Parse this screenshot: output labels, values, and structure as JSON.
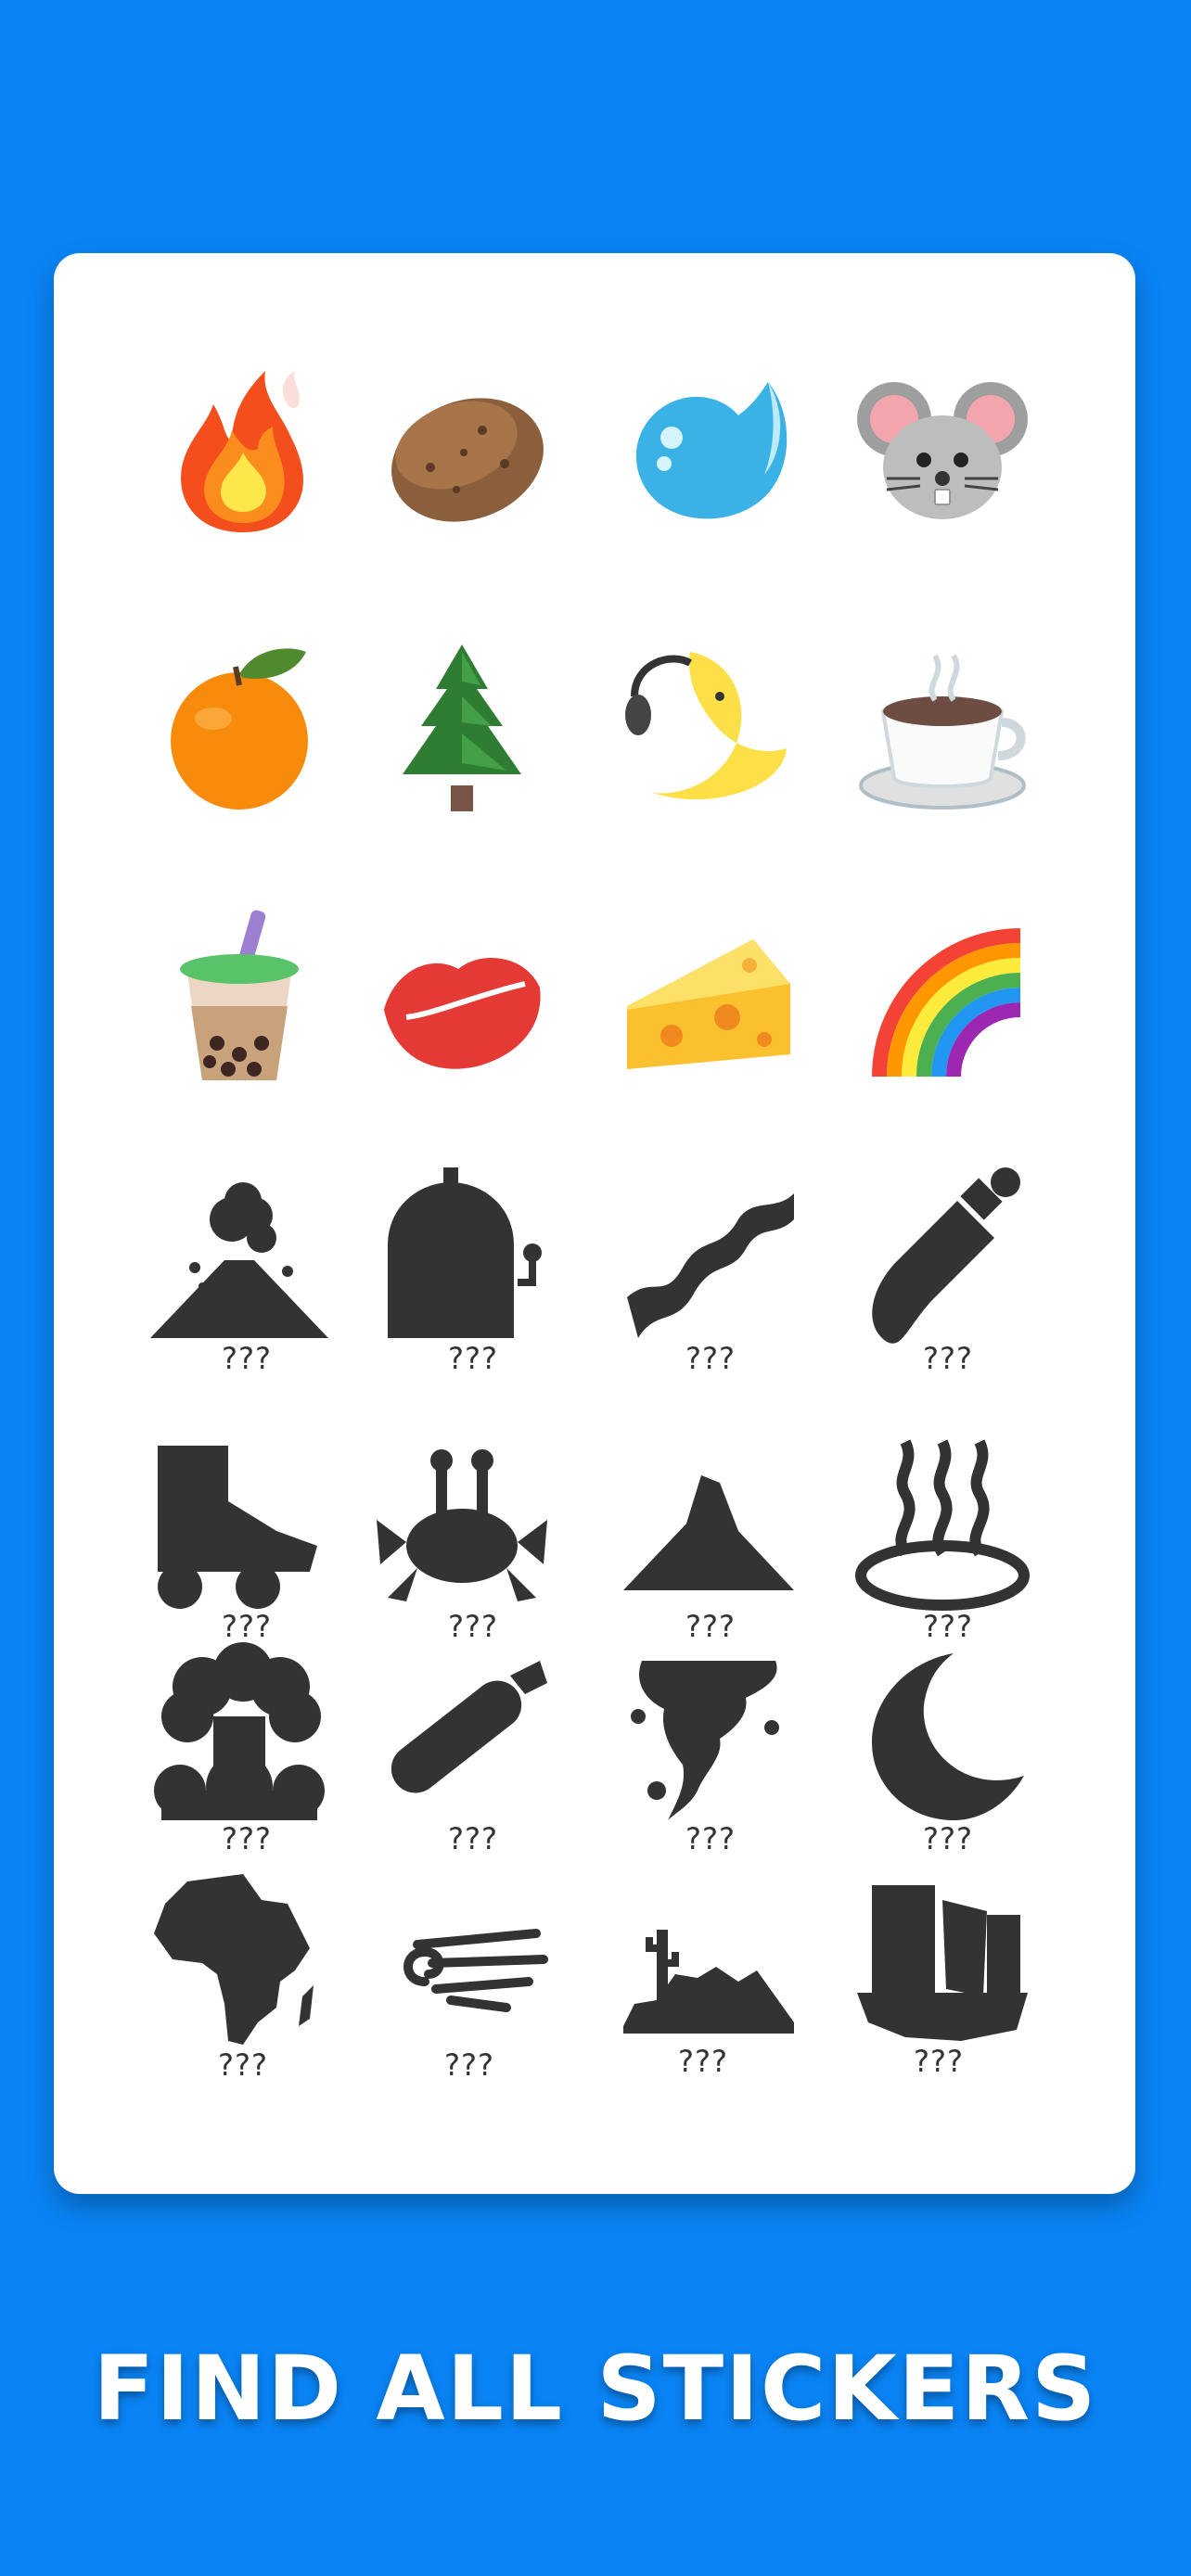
{
  "unlocked": [
    {
      "name": "fire-sticker",
      "icon": "fire-icon"
    },
    {
      "name": "potato-sticker",
      "icon": "potato-icon"
    },
    {
      "name": "water-drop-sticker",
      "icon": "water-drop-icon"
    },
    {
      "name": "mouse-sticker",
      "icon": "mouse-face-icon"
    },
    {
      "name": "tangerine-sticker",
      "icon": "tangerine-icon"
    },
    {
      "name": "evergreen-tree-sticker",
      "icon": "evergreen-tree-icon"
    },
    {
      "name": "moon-headphones-sticker",
      "icon": "moon-face-headphones-icon"
    },
    {
      "name": "hot-beverage-sticker",
      "icon": "hot-beverage-icon"
    },
    {
      "name": "bubble-tea-sticker",
      "icon": "bubble-tea-icon"
    },
    {
      "name": "kiss-mark-sticker",
      "icon": "kiss-mark-icon"
    },
    {
      "name": "cheese-sticker",
      "icon": "cheese-wedge-icon"
    },
    {
      "name": "rainbow-sticker",
      "icon": "rainbow-icon"
    }
  ],
  "locked": [
    {
      "icon": "volcano-silhouette-icon",
      "label": "???"
    },
    {
      "icon": "slot-machine-silhouette-icon",
      "label": "???"
    },
    {
      "icon": "bacon-silhouette-icon",
      "label": "???"
    },
    {
      "icon": "baby-bottle-silhouette-icon",
      "label": "???"
    },
    {
      "icon": "roller-skate-silhouette-icon",
      "label": "???"
    },
    {
      "icon": "crab-silhouette-icon",
      "label": "???"
    },
    {
      "icon": "mountain-silhouette-icon",
      "label": "???"
    },
    {
      "icon": "hot-springs-silhouette-icon",
      "label": "???"
    },
    {
      "icon": "mushroom-cloud-silhouette-icon",
      "label": "???"
    },
    {
      "icon": "fire-extinguisher-silhouette-icon",
      "label": "???"
    },
    {
      "icon": "tornado-silhouette-icon",
      "label": "???"
    },
    {
      "icon": "crescent-moon-silhouette-icon",
      "label": "???"
    },
    {
      "icon": "africa-silhouette-icon",
      "label": "???"
    },
    {
      "icon": "wind-silhouette-icon",
      "label": "???"
    },
    {
      "icon": "desert-silhouette-icon",
      "label": "???"
    },
    {
      "icon": "broken-building-silhouette-icon",
      "label": "???"
    }
  ],
  "footer": {
    "title": "FIND ALL STICKERS"
  },
  "colors": {
    "background": "#0a84f5",
    "card": "#ffffff",
    "silhouette": "#333333"
  }
}
